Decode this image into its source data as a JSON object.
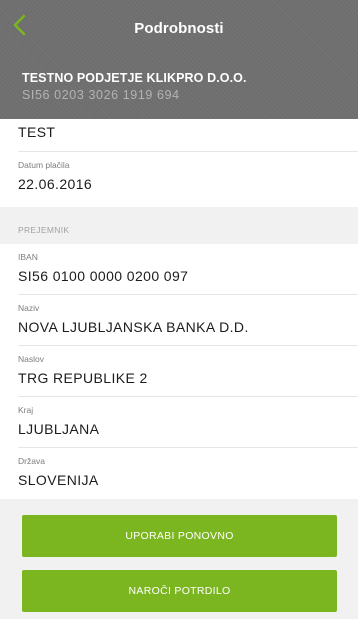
{
  "header": {
    "title": "Podrobnosti",
    "account_name": "TESTNO PODJETJE KLIKPRO D.O.O.",
    "account_iban": "SI56 0203 3026 1919 694"
  },
  "colors": {
    "accent": "#7bb520",
    "header_bg": "#6e6e6e"
  },
  "icons": {
    "back": "chevron-left-icon"
  },
  "details": {
    "purpose": "TEST",
    "payment_date_label": "Datum plačila",
    "payment_date": "22.06.2016"
  },
  "recipient": {
    "section_title": "PREJEMNIK",
    "iban_label": "IBAN",
    "iban": "SI56 0100 0000 0200 097",
    "name_label": "Naziv",
    "name": "NOVA LJUBLJANSKA BANKA D.D.",
    "address_label": "Naslov",
    "address": "TRG REPUBLIKE 2",
    "city_label": "Kraj",
    "city": "LJUBLJANA",
    "country_label": "Država",
    "country": "SLOVENIJA"
  },
  "actions": {
    "reuse_label": "UPORABI PONOVNO",
    "order_confirmation_label": "NAROČI POTRDILO"
  }
}
